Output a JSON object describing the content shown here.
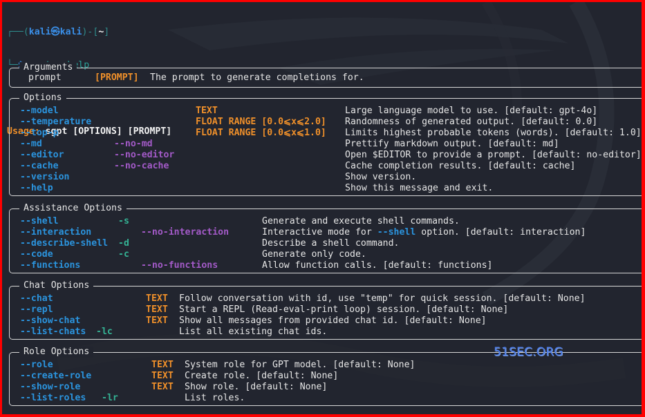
{
  "prompt": {
    "corner_top": "┌──(",
    "user": "kali",
    "at_symbol": "㉿",
    "host": "kali",
    "close_paren": ")-[",
    "cwd": "~",
    "close_bracket": "]",
    "corner_bottom": "└─",
    "dollar": "$",
    "command": "sgpt --help"
  },
  "usage": {
    "label": "Usage:",
    "text": "sgpt [OPTIONS] [PROMPT]"
  },
  "panels": {
    "arguments": {
      "title": "Arguments",
      "rows": [
        {
          "name": "prompt",
          "type": "[PROMPT]",
          "desc": "The prompt to generate completions for."
        }
      ]
    },
    "options": {
      "title": "Options",
      "rows": [
        {
          "opt": "--model",
          "neg": "",
          "type": "TEXT",
          "desc": "Large language model to use. [default: gpt-4o]"
        },
        {
          "opt": "--temperature",
          "neg": "",
          "type": "FLOAT RANGE [0.0⩽x⩽2.0]",
          "desc": "Randomness of generated output. [default: 0.0]"
        },
        {
          "opt": "--top-p",
          "neg": "",
          "type": "FLOAT RANGE [0.0⩽x⩽1.0]",
          "desc": "Limits highest probable tokens (words). [default: 1.0]"
        },
        {
          "opt": "--md",
          "neg": "--no-md",
          "type": "",
          "desc": "Prettify markdown output. [default: md]"
        },
        {
          "opt": "--editor",
          "neg": "--no-editor",
          "type": "",
          "desc": "Open $EDITOR to provide a prompt. [default: no-editor]"
        },
        {
          "opt": "--cache",
          "neg": "--no-cache",
          "type": "",
          "desc": "Cache completion results. [default: cache]"
        },
        {
          "opt": "--version",
          "neg": "",
          "type": "",
          "desc": "Show version."
        },
        {
          "opt": "--help",
          "neg": "",
          "type": "",
          "desc": "Show this message and exit."
        }
      ]
    },
    "assistance": {
      "title": "Assistance Options",
      "rows": [
        {
          "opt": "--shell",
          "short": "-s",
          "neg": "",
          "desc": "Generate and execute shell commands."
        },
        {
          "opt": "--interaction",
          "short": "",
          "neg": "--no-interaction",
          "desc_pre": "Interactive mode for ",
          "desc_opt": "--shell",
          "desc": " option. [default: interaction]"
        },
        {
          "opt": "--describe-shell",
          "short": "-d",
          "neg": "",
          "desc": "Describe a shell command."
        },
        {
          "opt": "--code",
          "short": "-c",
          "neg": "",
          "desc": "Generate only code."
        },
        {
          "opt": "--functions",
          "short": "",
          "neg": "--no-functions",
          "desc": "Allow function calls. [default: functions]"
        }
      ]
    },
    "chat": {
      "title": "Chat Options",
      "rows": [
        {
          "opt": "--chat",
          "short": "",
          "type": "TEXT",
          "desc": "Follow conversation with id, use \"temp\" for quick session. [default: None]"
        },
        {
          "opt": "--repl",
          "short": "",
          "type": "TEXT",
          "desc": "Start a REPL (Read-eval-print loop) session. [default: None]"
        },
        {
          "opt": "--show-chat",
          "short": "",
          "type": "TEXT",
          "desc": "Show all messages from provided chat id. [default: None]"
        },
        {
          "opt": "--list-chats",
          "short": "-lc",
          "type": "",
          "desc": "List all existing chat ids."
        }
      ]
    },
    "role": {
      "title": "Role Options",
      "rows": [
        {
          "opt": "--role",
          "short": "",
          "type": "TEXT",
          "desc": "System role for GPT model. [default: None]"
        },
        {
          "opt": "--create-role",
          "short": "",
          "type": "TEXT",
          "desc": "Create role. [default: None]"
        },
        {
          "opt": "--show-role",
          "short": "",
          "type": "TEXT",
          "desc": "Show role. [default: None]"
        },
        {
          "opt": "--list-roles",
          "short": "-lr",
          "type": "",
          "desc": "List roles."
        }
      ]
    }
  },
  "watermark": "51SEC.ORG",
  "colors": {
    "frame": "#ff0000",
    "background": "#22252f",
    "option": "#2b94de",
    "negation": "#a35ac8",
    "short_flag": "#34b394",
    "type": "#f0902a",
    "text": "#e6e6e6"
  }
}
